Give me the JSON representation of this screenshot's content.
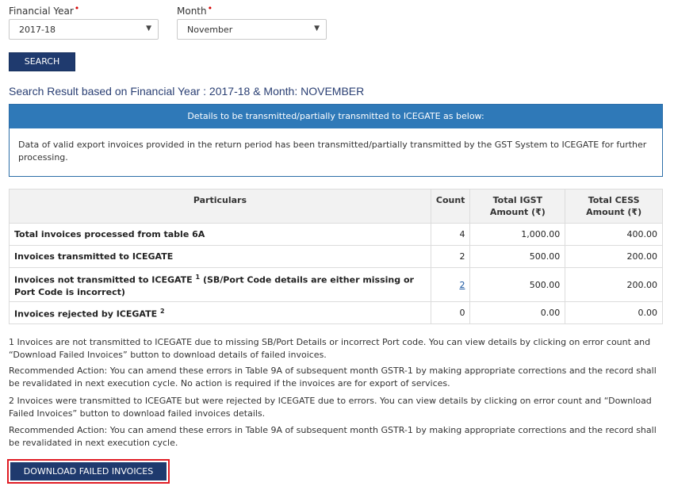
{
  "filters": {
    "financial_year_label": "Financial Year",
    "financial_year_value": "2017-18",
    "month_label": "Month",
    "month_value": "November",
    "required_marker": "•",
    "search_button": "SEARCH"
  },
  "result_title": "Search Result based on Financial Year : 2017-18 & Month: NOVEMBER",
  "info_box": {
    "header": "Details to be transmitted/partially transmitted to ICEGATE as below:",
    "body": "Data of valid export invoices provided in the return period has been transmitted/partially transmitted by the GST System to ICEGATE for further processing."
  },
  "table": {
    "headers": {
      "particulars": "Particulars",
      "count": "Count",
      "igst": "Total IGST Amount (₹)",
      "cess": "Total CESS Amount (₹)"
    },
    "rows": [
      {
        "particulars": "Total invoices processed from table 6A",
        "sup": "",
        "count": "4",
        "igst": "1,000.00",
        "cess": "400.00"
      },
      {
        "particulars": "Invoices transmitted to ICEGATE",
        "sup": "",
        "count": "2",
        "igst": "500.00",
        "cess": "200.00"
      },
      {
        "particulars": "Invoices not transmitted to ICEGATE",
        "sup": "1",
        "particulars_suffix": " (SB/Port Code details are either missing or Port Code is incorrect)",
        "count": "2",
        "igst": "500.00",
        "cess": "200.00"
      },
      {
        "particulars": "Invoices rejected by ICEGATE",
        "sup": "2",
        "count": "0",
        "igst": "0.00",
        "cess": "0.00"
      }
    ]
  },
  "notes": {
    "note1": "1 Invoices are not transmitted to ICEGATE due to missing SB/Port Details or incorrect Port code. You can view details by clicking on error count and “Download Failed Invoices” button to download details of failed invoices.",
    "action1": "Recommended Action: You can amend these errors in Table 9A of subsequent month GSTR-1 by making appropriate corrections and the record shall be revalidated in next execution cycle. No action is required if the invoices are for export of services.",
    "note2": "2 Invoices were transmitted to ICEGATE but were rejected by ICEGATE due to errors. You can view details by clicking on error count and “Download Failed Invoices” button to download failed invoices details.",
    "action2": "Recommended Action: You can amend these errors in Table 9A of subsequent month GSTR-1 by making appropriate corrections and the record shall be revalidated in next execution cycle."
  },
  "download_button": "DOWNLOAD FAILED INVOICES"
}
